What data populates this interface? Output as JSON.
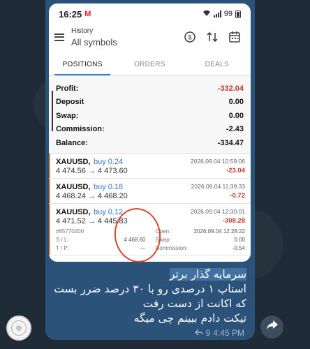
{
  "statusbar": {
    "time": "16:25",
    "mail": "M",
    "battery": "99"
  },
  "header": {
    "subtitle": "History",
    "title": "All symbols"
  },
  "tabs": [
    "POSITIONS",
    "ORDERS",
    "DEALS"
  ],
  "summary": [
    {
      "label": "Profit:",
      "value": "-332.04",
      "negative": true
    },
    {
      "label": "Deposit",
      "value": "0.00",
      "negative": false
    },
    {
      "label": "Swap:",
      "value": "0.00",
      "negative": false
    },
    {
      "label": "Commission:",
      "value": "-2.43",
      "negative": false
    },
    {
      "label": "Balance:",
      "value": "-334.47",
      "negative": false
    }
  ],
  "trades": [
    {
      "symbol": "XAUUSD,",
      "side": "buy 0.24",
      "date": "2026.09.04 10:59:06",
      "prices": "4 474.56 → 4 473.60",
      "pl": "-23.04"
    },
    {
      "symbol": "XAUUSD,",
      "side": "buy 0.18",
      "date": "2026.09.04 11:39:33",
      "prices": "4 468.24 → 4 468.20",
      "pl": "-0.72"
    },
    {
      "symbol": "XAUUSD,",
      "side": "buy 0.12",
      "date": "2026.09.04 12:30:01",
      "prices": "4 471.52 → 4 445.83",
      "pl": "-308.28",
      "details": {
        "id": "#65770200",
        "open_label": "Open:",
        "open": "2026.09.04 12:28:22",
        "sl_label": "S / L:",
        "sl": "4 468.60",
        "swap_label": "Swap:",
        "swap": "0.00",
        "tp_label": "T / P:",
        "tp": "—",
        "commission_label": "Commission:",
        "commission": "-0.54"
      }
    }
  ],
  "message": {
    "line1": "سرمایه گذار برتر",
    "line2": "استاپ ۱ درصدی رو با ۳۰ درصد ضرر بست",
    "line3": "که اکانت از دست رفت",
    "line4": "تیکت دادم ببینم چی میگه",
    "views": "9",
    "time": "4:45 PM"
  },
  "colors": {
    "accent": "#2e7ad1",
    "loss": "#c0392b",
    "trade_accent": "#e0823a",
    "bubble": "#2b5278"
  }
}
